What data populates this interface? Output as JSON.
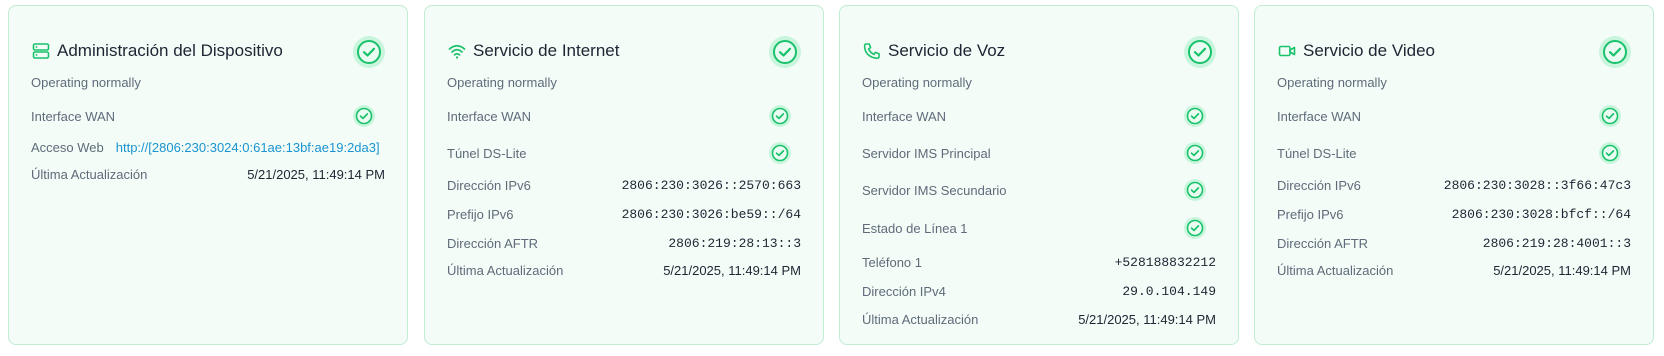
{
  "colors": {
    "accent_green": "#19c26b",
    "card_bg": "#f3fcf7",
    "card_border": "#bfeed3",
    "link": "#1a94d1"
  },
  "cards": [
    {
      "icon": "server-icon",
      "title": "Administración del Dispositivo",
      "status": "Operating normally",
      "rows": [
        {
          "label": "Interface WAN",
          "check": true
        },
        {
          "label": "Acceso Web",
          "link": "http://[2806:230:3024:0:61ae:13bf:ae19:2da3]"
        },
        {
          "label": "Última Actualización",
          "value": "5/21/2025, 11:49:14 PM"
        }
      ]
    },
    {
      "icon": "wifi-icon",
      "title": "Servicio de Internet",
      "status": "Operating normally",
      "rows": [
        {
          "label": "Interface WAN",
          "check": true
        },
        {
          "label": "Túnel DS-Lite",
          "check": true
        },
        {
          "label": "Dirección IPv6",
          "value": "2806:230:3026::2570:663"
        },
        {
          "label": "Prefijo IPv6",
          "value": "2806:230:3026:be59::/64"
        },
        {
          "label": "Dirección AFTR",
          "value": "2806:219:28:13::3"
        },
        {
          "label": "Última Actualización",
          "value": "5/21/2025, 11:49:14 PM"
        }
      ]
    },
    {
      "icon": "phone-icon",
      "title": "Servicio de Voz",
      "status": "Operating normally",
      "rows": [
        {
          "label": "Interface WAN",
          "check": true
        },
        {
          "label": "Servidor IMS Principal",
          "check": true
        },
        {
          "label": "Servidor IMS Secundario",
          "check": true
        },
        {
          "label": "Estado de Línea 1",
          "check": true
        },
        {
          "label": "Teléfono 1",
          "value": "+528188832212"
        },
        {
          "label": "Dirección IPv4",
          "value": "29.0.104.149"
        },
        {
          "label": "Última Actualización",
          "value": "5/21/2025, 11:49:14 PM"
        }
      ]
    },
    {
      "icon": "video-camera-icon",
      "title": "Servicio de Video",
      "status": "Operating normally",
      "rows": [
        {
          "label": "Interface WAN",
          "check": true
        },
        {
          "label": "Túnel DS-Lite",
          "check": true
        },
        {
          "label": "Dirección IPv6",
          "value": "2806:230:3028::3f66:47c3"
        },
        {
          "label": "Prefijo IPv6",
          "value": "2806:230:3028:bfcf::/64"
        },
        {
          "label": "Dirección AFTR",
          "value": "2806:219:28:4001::3"
        },
        {
          "label": "Última Actualización",
          "value": "5/21/2025, 11:49:14 PM"
        }
      ]
    }
  ]
}
